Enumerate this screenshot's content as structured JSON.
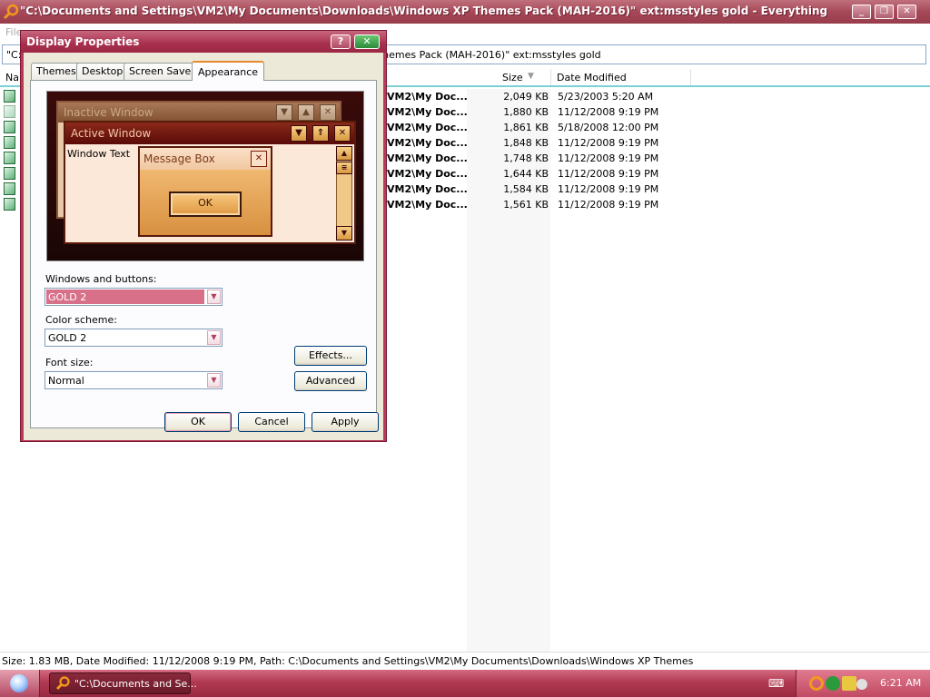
{
  "main_window": {
    "title": "\"C:\\Documents and Settings\\VM2\\My Documents\\Downloads\\Windows XP Themes Pack (MAH-2016)\" ext:msstyles gold - Everything",
    "controls": {
      "minimize": "_",
      "maximize": "❐",
      "close": "✕"
    },
    "menu_file": "File"
  },
  "search": {
    "value": "\"C:\\Documents and Settings\\VM2\\My Documents\\Downloads\\Windows XP Themes Pack (MAH-2016)\" ext:msstyles gold"
  },
  "columns": {
    "name": "Name",
    "size": "Size",
    "date_modified": "Date Modified"
  },
  "files": [
    {
      "path": "VM2\\My Doc...",
      "size": "2,049 KB",
      "date": "5/23/2003 5:20 AM"
    },
    {
      "path": "VM2\\My Doc...",
      "size": "1,880 KB",
      "date": "11/12/2008 9:19 PM"
    },
    {
      "path": "VM2\\My Doc...",
      "size": "1,861 KB",
      "date": "5/18/2008 12:00 PM"
    },
    {
      "path": "VM2\\My Doc...",
      "size": "1,848 KB",
      "date": "11/12/2008 9:19 PM"
    },
    {
      "path": "VM2\\My Doc...",
      "size": "1,748 KB",
      "date": "11/12/2008 9:19 PM"
    },
    {
      "path": "VM2\\My Doc...",
      "size": "1,644 KB",
      "date": "11/12/2008 9:19 PM"
    },
    {
      "path": "VM2\\My Doc...",
      "size": "1,584 KB",
      "date": "11/12/2008 9:19 PM"
    },
    {
      "path": "VM2\\My Doc...",
      "size": "1,561 KB",
      "date": "11/12/2008 9:19 PM"
    }
  ],
  "status": "Size: 1.83 MB, Date Modified: 11/12/2008 9:19 PM, Path: C:\\Documents and Settings\\VM2\\My Documents\\Downloads\\Windows XP Themes",
  "dialog": {
    "title": "Display Properties",
    "help": "?",
    "close": "✕",
    "tabs": [
      "Themes",
      "Desktop",
      "Screen Saver",
      "Appearance"
    ],
    "active_tab": "Appearance",
    "preview": {
      "inactive_window": "Inactive Window",
      "active_window": "Active Window",
      "window_text": "Window Text",
      "message_box": "Message Box",
      "ok": "OK"
    },
    "windows_and_buttons_label": "Windows and buttons:",
    "windows_and_buttons_value": "GOLD 2",
    "color_scheme_label": "Color scheme:",
    "color_scheme_value": "GOLD 2",
    "font_size_label": "Font size:",
    "font_size_value": "Normal",
    "effects_button": "Effects...",
    "advanced_button": "Advanced",
    "ok_button": "OK",
    "cancel_button": "Cancel",
    "apply_button": "Apply"
  },
  "taskbar": {
    "task_label": "\"C:\\Documents and Se...",
    "clock": "6:21 AM"
  },
  "colors": {
    "titlebar": "#a64858",
    "taskbar": "#b03a52",
    "dialog_frame": "#b83a5a",
    "header_accent": "#7ccfd2"
  }
}
